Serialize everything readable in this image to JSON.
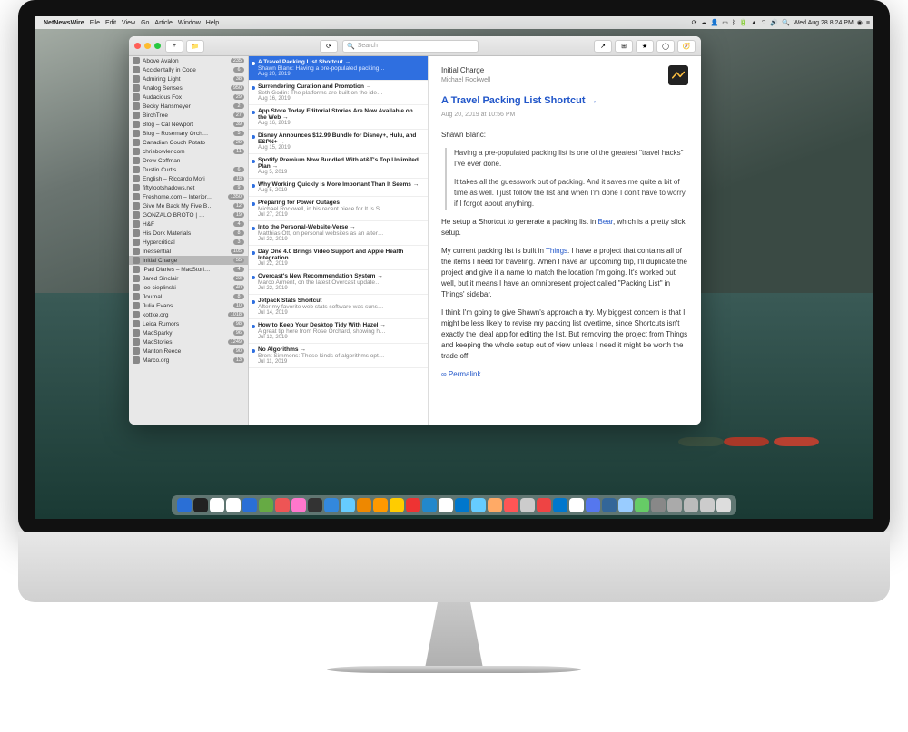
{
  "menubar": {
    "app_name": "NetNewsWire",
    "menus": [
      "File",
      "Edit",
      "View",
      "Go",
      "Article",
      "Window",
      "Help"
    ],
    "right_icons": [
      "sync-icon",
      "cloud-icon",
      "user-icon",
      "display-icon",
      "bluetooth-icon",
      "battery-icon",
      "airplay-icon",
      "wifi-icon",
      "volume-icon",
      "search-icon"
    ],
    "clock": "Wed Aug 28  8:24 PM",
    "extras": [
      "siri-icon",
      "notification-icon"
    ]
  },
  "toolbar": {
    "search_placeholder": "Search"
  },
  "sidebar": {
    "items": [
      {
        "label": "Above Avalon",
        "badge": "235"
      },
      {
        "label": "Accidentally in Code",
        "badge": "6"
      },
      {
        "label": "Admiring Light",
        "badge": "38"
      },
      {
        "label": "Analog Senses",
        "badge": "950"
      },
      {
        "label": "Audacious Fox",
        "badge": "29"
      },
      {
        "label": "Becky Hansmeyer",
        "badge": "2"
      },
      {
        "label": "BirchTree",
        "badge": "27"
      },
      {
        "label": "Blog – Cal Newport",
        "badge": "39"
      },
      {
        "label": "Blog – Rosemary Orch…",
        "badge": "5"
      },
      {
        "label": "Canadian Couch Potato",
        "badge": "29"
      },
      {
        "label": "chrisbowler.com",
        "badge": "11"
      },
      {
        "label": "Drew Coffman",
        "badge": ""
      },
      {
        "label": "Dustin Curtis",
        "badge": "6"
      },
      {
        "label": "English – Riccardo Mori",
        "badge": "18"
      },
      {
        "label": "fiftyfootshadows.net",
        "badge": "9"
      },
      {
        "label": "Freshome.com – Interior…",
        "badge": "1350"
      },
      {
        "label": "Give Me Back My Five B…",
        "badge": "12"
      },
      {
        "label": "GONZALO BROTO | …",
        "badge": "19"
      },
      {
        "label": "H&F",
        "badge": "4"
      },
      {
        "label": "His Dork Materials",
        "badge": "8"
      },
      {
        "label": "Hypercritical",
        "badge": "3"
      },
      {
        "label": "Inessential",
        "badge": "105"
      },
      {
        "label": "Initial Charge",
        "badge": "55",
        "selected": true
      },
      {
        "label": "iPad Diaries – MacStori…",
        "badge": "4"
      },
      {
        "label": "Jared Sinclair",
        "badge": "23"
      },
      {
        "label": "joe cieplinski",
        "badge": "40"
      },
      {
        "label": "Journal",
        "badge": "8"
      },
      {
        "label": "Julia Evans",
        "badge": "10"
      },
      {
        "label": "kottke.org",
        "badge": "1018"
      },
      {
        "label": "Leica Rumors",
        "badge": "98"
      },
      {
        "label": "MacSparky",
        "badge": "96"
      },
      {
        "label": "MacStories",
        "badge": "1249"
      },
      {
        "label": "Manton Reece",
        "badge": "90"
      },
      {
        "label": "Marco.org",
        "badge": "13"
      }
    ]
  },
  "timeline": {
    "items": [
      {
        "title": "A Travel Packing List Shortcut →",
        "sub": "Shawn Blanc: Having a pre-populated packing…",
        "date": "Aug 20, 2019",
        "selected": true
      },
      {
        "title": "Surrendering Curation and Promotion →",
        "sub": "Seth Godin: The platforms are built on the ide…",
        "date": "Aug 16, 2019"
      },
      {
        "title": "App Store Today Editorial Stories Are Now Available on the Web →",
        "sub": "",
        "date": "Aug 16, 2019"
      },
      {
        "title": "Disney Announces $12.99 Bundle for Disney+, Hulu, and ESPN+ →",
        "sub": "",
        "date": "Aug 15, 2019"
      },
      {
        "title": "Spotify Premium Now Bundled With at&T's Top Unlimited Plan →",
        "sub": "",
        "date": "Aug 5, 2019"
      },
      {
        "title": "Why Working Quickly Is More Important Than It Seems →",
        "sub": "",
        "date": "Aug 5, 2019"
      },
      {
        "title": "Preparing for Power Outages",
        "sub": "Michael Rockwell, in his recent piece for It Is S…",
        "date": "Jul 27, 2019"
      },
      {
        "title": "Into the Personal-Website-Verse →",
        "sub": "Matthias Ott, on personal websites as an alter…",
        "date": "Jul 22, 2019"
      },
      {
        "title": "Day One 4.0 Brings Video Support and Apple Health Integration",
        "sub": "",
        "date": "Jul 22, 2019"
      },
      {
        "title": "Overcast's New Recommendation System →",
        "sub": "Marco Arment, on the latest Overcast update…",
        "date": "Jul 22, 2019"
      },
      {
        "title": "Jetpack Stats Shortcut",
        "sub": "After my favorite web stats software was suns…",
        "date": "Jul 14, 2019"
      },
      {
        "title": "How to Keep Your Desktop Tidy With Hazel →",
        "sub": "A great tip here from Rose Orchard, showing h…",
        "date": "Jul 13, 2019"
      },
      {
        "title": "No Algorithms →",
        "sub": "Brent Simmons: These kinds of algorithms opt…",
        "date": "Jul 11, 2019"
      }
    ]
  },
  "article": {
    "feed": "Initial Charge",
    "author": "Michael Rockwell",
    "title": "A Travel Packing List Shortcut →",
    "date": "Aug 20, 2019 at 10:56 PM",
    "p_intro": "Shawn Blanc:",
    "quote1": "Having a pre-populated packing list is one of the greatest \"travel hacks\" I've ever done.",
    "quote2": "It takes all the guesswork out of packing. And it saves me quite a bit of time as well. I just follow the list and when I'm done I don't have to worry if I forgot about anything.",
    "p2a": "He setup a Shortcut to generate a packing list in ",
    "p2link": "Bear",
    "p2b": ", which is a pretty slick setup.",
    "p3a": "My current packing list is built in ",
    "p3link": "Things",
    "p3b": ". I have a project that contains all of the items I need for traveling. When I have an upcoming trip, I'll duplicate the project and give it a name to match the location I'm going. It's worked out well, but it means I have an omnipresent project called \"Packing List\" in Things' sidebar.",
    "p4": "I think I'm going to give Shawn's approach a try. My biggest concern is that I might be less likely to revise my packing list overtime, since Shortcuts isn't exactly the ideal app for editing the list. But removing the project from Things and keeping the whole setup out of view unless I need it might be worth the trade off.",
    "permalink": "∞ Permalink"
  },
  "dock": {
    "count": 34
  }
}
